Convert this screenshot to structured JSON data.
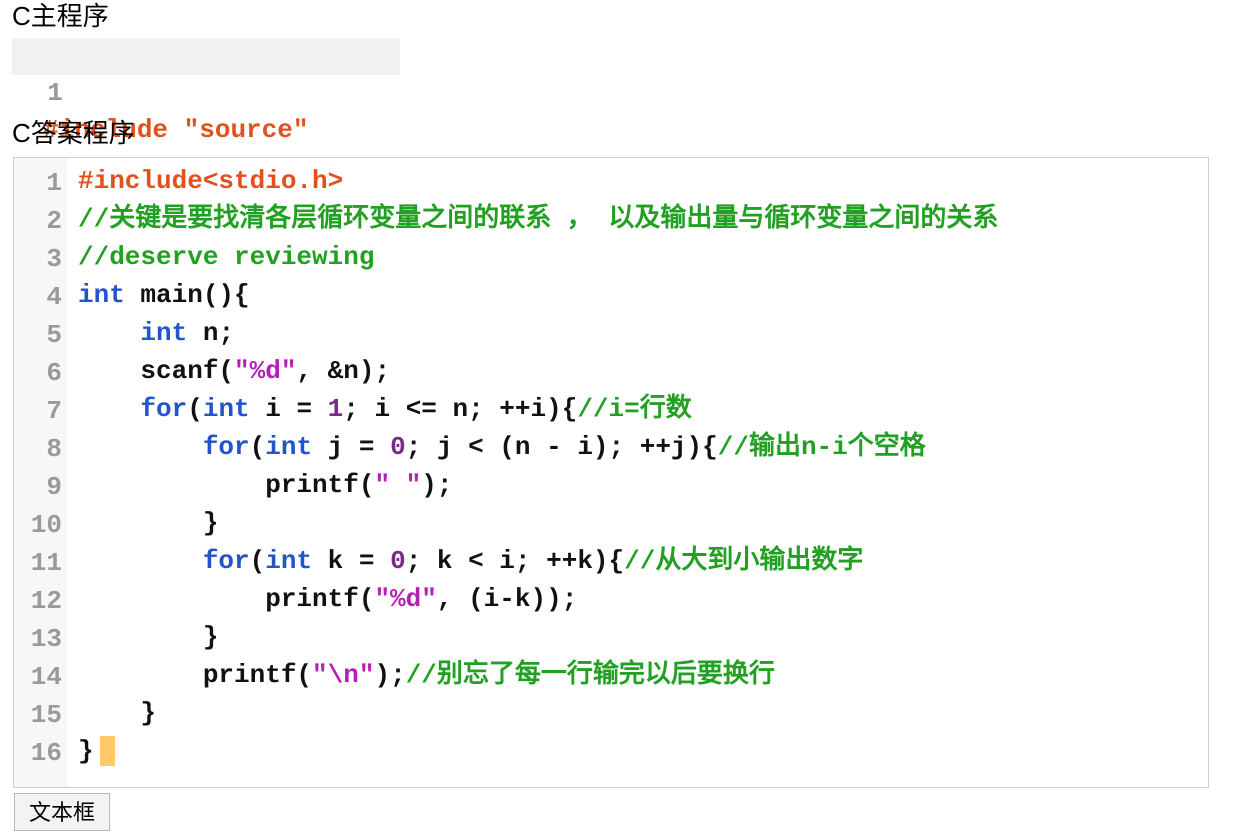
{
  "main_program": {
    "title": "C主程序",
    "line_number": "1",
    "code": "#include \"source\""
  },
  "answer_program": {
    "title": "C答案程序",
    "lines": [
      {
        "n": "1",
        "tokens": [
          {
            "t": "#include<stdio.h>",
            "c": "pre"
          }
        ]
      },
      {
        "n": "2",
        "tokens": [
          {
            "t": "//关键是要找清各层循环变量之间的联系 ， 以及输出量与循环变量之间的关系",
            "c": "cmt"
          }
        ]
      },
      {
        "n": "3",
        "tokens": [
          {
            "t": "//deserve reviewing",
            "c": "cmt"
          }
        ]
      },
      {
        "n": "4",
        "tokens": [
          {
            "t": "int",
            "c": "kw"
          },
          {
            "t": " main(){",
            "c": "plain"
          }
        ]
      },
      {
        "n": "5",
        "tokens": [
          {
            "t": "    ",
            "c": "plain"
          },
          {
            "t": "int",
            "c": "kw"
          },
          {
            "t": " n;",
            "c": "plain"
          }
        ]
      },
      {
        "n": "6",
        "tokens": [
          {
            "t": "    scanf(",
            "c": "plain"
          },
          {
            "t": "\"%d\"",
            "c": "str"
          },
          {
            "t": ", &n);",
            "c": "plain"
          }
        ]
      },
      {
        "n": "7",
        "tokens": [
          {
            "t": "    ",
            "c": "plain"
          },
          {
            "t": "for",
            "c": "kw"
          },
          {
            "t": "(",
            "c": "plain"
          },
          {
            "t": "int",
            "c": "kw"
          },
          {
            "t": " i = ",
            "c": "plain"
          },
          {
            "t": "1",
            "c": "num-lit"
          },
          {
            "t": "; i <= n; ++i){",
            "c": "plain"
          },
          {
            "t": "//i=行数",
            "c": "cmt"
          }
        ]
      },
      {
        "n": "8",
        "tokens": [
          {
            "t": "        ",
            "c": "plain"
          },
          {
            "t": "for",
            "c": "kw"
          },
          {
            "t": "(",
            "c": "plain"
          },
          {
            "t": "int",
            "c": "kw"
          },
          {
            "t": " j = ",
            "c": "plain"
          },
          {
            "t": "0",
            "c": "num-lit"
          },
          {
            "t": "; j < (n - i); ++j){",
            "c": "plain"
          },
          {
            "t": "//输出n-i个空格",
            "c": "cmt"
          }
        ]
      },
      {
        "n": "9",
        "tokens": [
          {
            "t": "            printf(",
            "c": "plain"
          },
          {
            "t": "\" \"",
            "c": "str"
          },
          {
            "t": ");",
            "c": "plain"
          }
        ]
      },
      {
        "n": "10",
        "tokens": [
          {
            "t": "        }",
            "c": "plain"
          }
        ]
      },
      {
        "n": "11",
        "tokens": [
          {
            "t": "        ",
            "c": "plain"
          },
          {
            "t": "for",
            "c": "kw"
          },
          {
            "t": "(",
            "c": "plain"
          },
          {
            "t": "int",
            "c": "kw"
          },
          {
            "t": " k = ",
            "c": "plain"
          },
          {
            "t": "0",
            "c": "num-lit"
          },
          {
            "t": "; k < i; ++k){",
            "c": "plain"
          },
          {
            "t": "//从大到小输出数字",
            "c": "cmt"
          }
        ]
      },
      {
        "n": "12",
        "tokens": [
          {
            "t": "            printf(",
            "c": "plain"
          },
          {
            "t": "\"%d\"",
            "c": "str"
          },
          {
            "t": ", (i-k));",
            "c": "plain"
          }
        ]
      },
      {
        "n": "13",
        "tokens": [
          {
            "t": "        }",
            "c": "plain"
          }
        ]
      },
      {
        "n": "14",
        "tokens": [
          {
            "t": "        printf(",
            "c": "plain"
          },
          {
            "t": "\"\\n\"",
            "c": "str"
          },
          {
            "t": ");",
            "c": "plain"
          },
          {
            "t": "//别忘了每一行输完以后要换行",
            "c": "cmt"
          }
        ]
      },
      {
        "n": "15",
        "tokens": [
          {
            "t": "    }",
            "c": "plain"
          }
        ]
      },
      {
        "n": "16",
        "tokens": [
          {
            "t": "}",
            "c": "plain"
          }
        ],
        "cursor": true
      }
    ]
  },
  "textbox_button": {
    "label": "文本框"
  },
  "colors": {
    "keyword": "#2255cc",
    "number": "#7a2a8a",
    "string": "#b61fb6",
    "preprocessor": "#e0511f",
    "comment": "#22a022",
    "cursor": "#ffc96b"
  }
}
